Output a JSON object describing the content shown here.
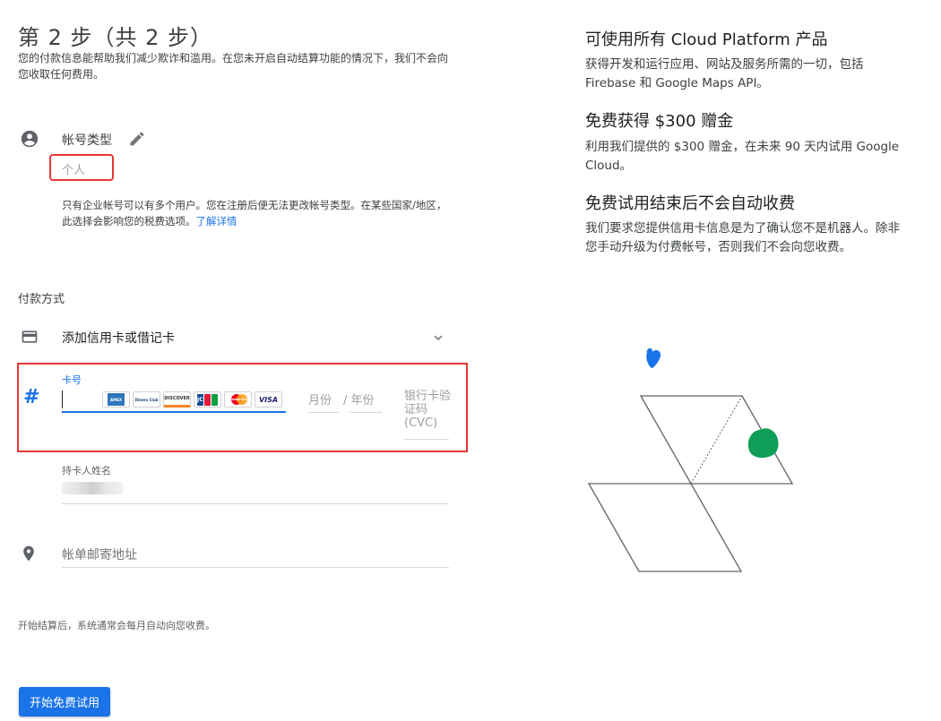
{
  "header": {
    "step_title": "第 2 步（共 2 步）",
    "intro": "您的付款信息能帮助我们减少欺诈和滥用。在您未开启自动结算功能的情况下，我们不会向您收取任何费用。"
  },
  "account": {
    "label": "帐号类型",
    "value": "个人",
    "note": "只有企业帐号可以有多个用户。您在注册后便无法更改帐号类型。在某些国家/地区，此选择会影响您的税费选项。",
    "learn_more": "了解详情"
  },
  "payment": {
    "title": "付款方式",
    "add_card": "添加信用卡或借记卡",
    "card_number_label": "卡号",
    "card_brands": [
      "AMEX",
      "Diners Club",
      "DISCOVER",
      "JCB",
      "MasterCard",
      "VISA"
    ],
    "month_placeholder": "月份",
    "year_placeholder": "/ 年份",
    "cvc_placeholder": "银行卡验证码 (CVC)",
    "holder_label": "持卡人姓名",
    "billing_address": "帐单邮寄地址",
    "footer_note": "开始结算后，系统通常会每月自动向您收费。",
    "start_button": "开始免费试用"
  },
  "benefits": [
    {
      "title": "可使用所有 Cloud Platform 产品",
      "text": "获得开发和运行应用、网站及服务所需的一切，包括 Firebase 和 Google Maps API。"
    },
    {
      "title": "免费获得 $300 赠金",
      "text": "利用我们提供的 $300 赠金，在未来 90 天内试用 Google Cloud。"
    },
    {
      "title": "免费试用结束后不会自动收费",
      "text": "我们要求您提供信用卡信息是为了确认您不是机器人。除非您手动升级为付费帐号，否则我们不会向您收费。"
    }
  ],
  "colors": {
    "accent": "#1a73e8",
    "highlight": "#e53935",
    "green": "#0f9d58"
  }
}
